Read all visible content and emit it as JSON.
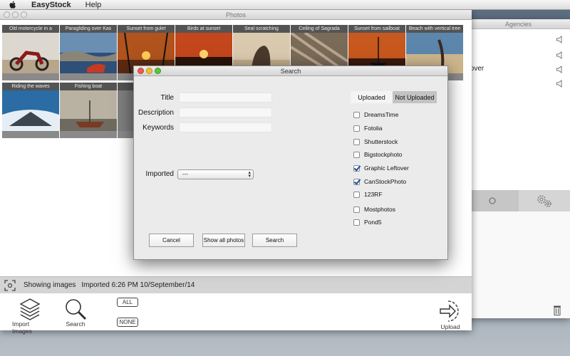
{
  "menubar": {
    "app_name": "EasyStock",
    "items": [
      "Help"
    ],
    "apple_icon": "apple-icon"
  },
  "agencies_window": {
    "title": "Agencies",
    "rows": [
      "e",
      "",
      "tover",
      ""
    ],
    "icons": [
      "speaker-icon",
      "gear-icon",
      "gears-icon",
      "trash-icon"
    ]
  },
  "photos_window": {
    "title": "Photos",
    "photos": [
      {
        "caption": "Old motorcycle in a"
      },
      {
        "caption": "Paragliding over Kas"
      },
      {
        "caption": "Sunset from gulet"
      },
      {
        "caption": "Birds at sunset"
      },
      {
        "caption": "Seal scratching"
      },
      {
        "caption": "Ceiling of Sagrada"
      },
      {
        "caption": "Sunset from sailboat"
      },
      {
        "caption": "Beach with vertical tree"
      },
      {
        "caption": "Riding the waves"
      },
      {
        "caption": "Fishing boat"
      },
      {
        "caption": "F"
      }
    ],
    "status_label": "Showing images",
    "status_value": "Imported 6:26 PM 10/September/14",
    "toolbar": {
      "import_label": "Import Images",
      "search_label": "Search",
      "all_label": "ALL",
      "none_label": "NONE",
      "upload_label": "Upload"
    }
  },
  "search_dialog": {
    "title": "Search",
    "fields": {
      "title_label": "Title",
      "title_value": "",
      "description_label": "Description",
      "description_value": "",
      "keywords_label": "Keywords",
      "keywords_value": ""
    },
    "imported_label": "Imported",
    "imported_selected": "---",
    "segment": {
      "uploaded": "Uploaded",
      "not_uploaded": "Not Uploaded",
      "selected": "Not Uploaded"
    },
    "agencies": [
      {
        "name": "DreamsTime",
        "checked": false
      },
      {
        "name": "Fotolia",
        "checked": false
      },
      {
        "name": "Shutterstock",
        "checked": false
      },
      {
        "name": "Bigstockphoto",
        "checked": false
      },
      {
        "name": "Graphic Leftover",
        "checked": true
      },
      {
        "name": "CanStockPhoto",
        "checked": true
      },
      {
        "name": "123RF",
        "checked": false
      },
      {
        "name": "Mostphotos",
        "checked": false
      },
      {
        "name": "Pond5",
        "checked": false
      }
    ],
    "buttons": {
      "cancel": "Cancel",
      "show_all": "Show all photos",
      "search": "Search"
    }
  },
  "colors": {
    "checkmark": "#1b4f9c",
    "close": "#ee5a4f",
    "minimize": "#f4bd35",
    "zoom": "#5bc63c"
  }
}
